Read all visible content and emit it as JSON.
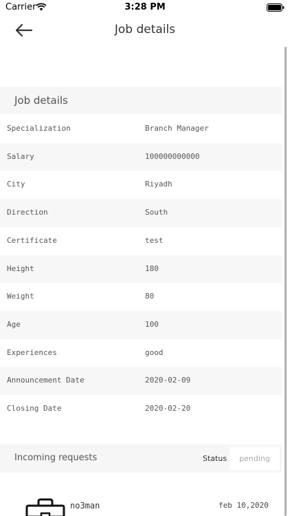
{
  "status_bar": {
    "carrier": "Carrier",
    "time": "3:28 PM"
  },
  "nav": {
    "title": "Job details",
    "back_icon": "arrow-left-icon"
  },
  "job_details": {
    "section_title": "Job details",
    "rows": [
      {
        "label": "Specialization",
        "value": "Branch Manager"
      },
      {
        "label": "Salary",
        "value": "100000000000"
      },
      {
        "label": "City",
        "value": "Riyadh"
      },
      {
        "label": "Direction",
        "value": "South"
      },
      {
        "label": "Certificate",
        "value": "test"
      },
      {
        "label": "Height",
        "value": "180"
      },
      {
        "label": "Weight",
        "value": "80"
      },
      {
        "label": "Age",
        "value": "100"
      },
      {
        "label": "Experiences",
        "value": "good"
      },
      {
        "label": "Announcement Date",
        "value": "2020-02-09"
      },
      {
        "label": "Closing Date",
        "value": "2020-02-20"
      }
    ]
  },
  "incoming_requests": {
    "section_title": "Incoming requests",
    "status_label": "Status",
    "status_value": "pending",
    "items": [
      {
        "name": "no3man",
        "date": "feb 10,2020",
        "icon": "briefcase-icon"
      }
    ]
  },
  "colors": {
    "section_background": "#f6f6f6",
    "row_alt_background": "#f7f7f7",
    "text": "#555555"
  }
}
